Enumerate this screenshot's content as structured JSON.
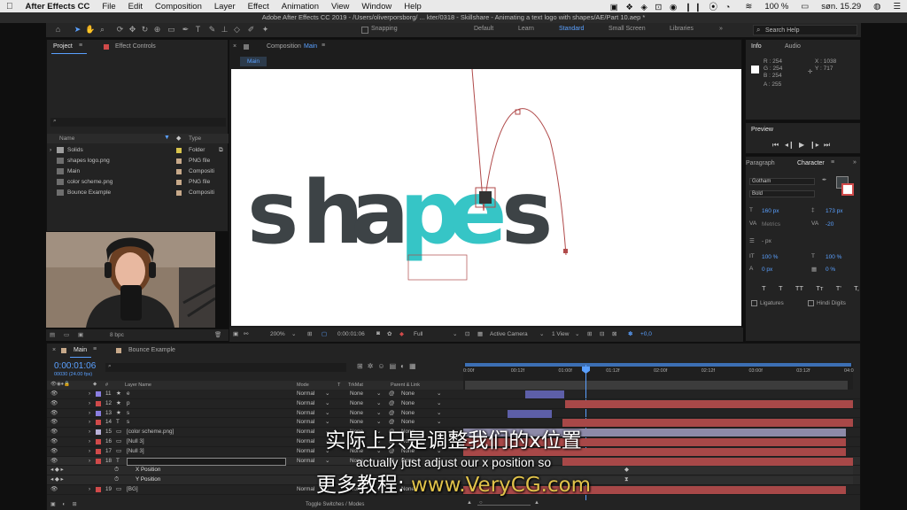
{
  "menubar": {
    "apple": "",
    "items": [
      "After Effects CC",
      "File",
      "Edit",
      "Composition",
      "Layer",
      "Effect",
      "Animation",
      "View",
      "Window",
      "Help"
    ],
    "battery": "100 %",
    "clock": "søn. 15.29"
  },
  "window_title": "Adobe After Effects CC 2019 - /Users/oliverporsborg/ ... kter/0318 - Skillshare - Animating a text logo with shapes/AE/Part 10.aep *",
  "toolbar": {
    "snapping": "Snapping",
    "workspaces": [
      "Default",
      "Learn",
      "Standard",
      "Small Screen",
      "Libraries"
    ],
    "active_workspace": "Standard",
    "search_placeholder": "Search Help"
  },
  "project": {
    "tab": "Project",
    "tab2": "Effect Controls",
    "col_name": "Name",
    "col_type": "Type",
    "items": [
      {
        "name": "Solids",
        "type": "Folder",
        "color": "#d8c34c"
      },
      {
        "name": "shapes logo.png",
        "type": "PNG file",
        "color": "#c7a98a"
      },
      {
        "name": "Main",
        "type": "Compositi",
        "color": "#c7a98a"
      },
      {
        "name": "color scheme.png",
        "type": "PNG file",
        "color": "#c7a98a"
      },
      {
        "name": "Bounce Example",
        "type": "Compositi",
        "color": "#c7a98a"
      }
    ],
    "bpc": "8 bpc"
  },
  "composition": {
    "tab_prefix": "Composition",
    "tab_name": "Main",
    "breadcrumb": "Main",
    "logo": {
      "s": "s",
      "h": "h",
      "a": "a",
      "p": "p",
      "e": "e",
      "s2": "s"
    },
    "zoom": "200%",
    "timecode": "0:00:01:06",
    "resolution": "Full",
    "camera": "Active Camera",
    "views": "1 View",
    "exposure": "+0,0"
  },
  "info": {
    "tab": "Info",
    "tab2": "Audio",
    "r": "R : 254",
    "g": "G : 254",
    "b": "B : 254",
    "a": "A : 255",
    "x": "X : 1038",
    "y": "Y : 717"
  },
  "preview": {
    "title": "Preview"
  },
  "character": {
    "tab": "Paragraph",
    "tab2": "Character",
    "font": "Gotham",
    "style": "Bold",
    "size": "160 px",
    "leading": "173 px",
    "kerning": "Metrics",
    "tracking": "-20",
    "stroke": "- px",
    "vscale": "100 %",
    "hscale": "100 %",
    "baseline": "0 px",
    "tsume": "0 %",
    "ligatures": "Ligatures",
    "hindi": "Hindi Digits",
    "styles": [
      "T",
      "T",
      "TT",
      "Tт",
      "T'",
      "T,"
    ]
  },
  "timeline": {
    "tab": "Main",
    "tab2": "Bounce Example",
    "timecode": "0:00:01:06",
    "frames": "00030 (24.00 fps)",
    "col_layer": "Layer Name",
    "col_mode": "Mode",
    "col_t": "T",
    "col_trkmat": "TrkMat",
    "col_parent": "Parent & Link",
    "ruler": [
      "0:00f",
      "00:12f",
      "01:00f",
      "01:12f",
      "02:00f",
      "02:12f",
      "03:00f",
      "03:12f",
      "04:0"
    ],
    "layers": [
      {
        "num": "11",
        "name": "e",
        "type": "star",
        "color": "#8a7ee0",
        "mode": "Normal",
        "trk": "None",
        "parent": "None"
      },
      {
        "num": "12",
        "name": "p",
        "type": "star",
        "color": "#d04a4a",
        "mode": "Normal",
        "trk": "None",
        "parent": "None"
      },
      {
        "num": "13",
        "name": "s",
        "type": "star",
        "color": "#8a7ee0",
        "mode": "Normal",
        "trk": "None",
        "parent": "None"
      },
      {
        "num": "14",
        "name": "s",
        "type": "T",
        "color": "#d04a4a",
        "mode": "Normal",
        "trk": "None",
        "parent": "None"
      },
      {
        "num": "15",
        "name": "[color scheme.png]",
        "type": "img",
        "color": "#b9b2d8",
        "mode": "Normal",
        "trk": "None",
        "parent": "None"
      },
      {
        "num": "16",
        "name": "[Null 3]",
        "type": "null",
        "color": "#d04a4a",
        "mode": "Normal",
        "trk": "None",
        "parent": "None"
      },
      {
        "num": "17",
        "name": "[Null 3]",
        "type": "null",
        "color": "#d04a4a",
        "mode": "Normal",
        "trk": "None",
        "parent": "None"
      },
      {
        "num": "18",
        "name": "",
        "type": "T",
        "color": "#d04a4a",
        "mode": "Normal",
        "trk": "None",
        "parent": "None"
      }
    ],
    "props": [
      "X Position",
      "Y Position"
    ],
    "last_layer": {
      "num": "19",
      "name": "[BG]",
      "color": "#d04a4a",
      "mode": "Normal",
      "trk": "None",
      "parent": "None"
    },
    "toggle": "Toggle Switches / Modes"
  },
  "subtitles": {
    "cn": "实际上只是调整我们的x位置",
    "en": "actually just adjust our x position so",
    "brand_cn": "更多教程:",
    "brand_url": "www.VeryCG.com"
  }
}
